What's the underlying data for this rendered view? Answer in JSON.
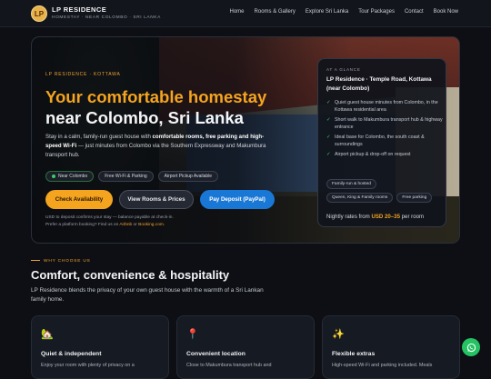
{
  "nav": {
    "logo_text": "LP",
    "brand": "LP RESIDENCE",
    "tagline": "HOMESTAY · NEAR COLOMBO · SRI LANKA",
    "items": [
      "Home",
      "Rooms & Gallery",
      "Explore Sri Lanka",
      "Tour Packages",
      "Contact",
      "Book Now"
    ]
  },
  "hero": {
    "eyebrow": "LP RESIDENCE · KOTTAWA",
    "headline_accent": "Your comfortable homestay",
    "headline_main": "near Colombo, Sri Lanka",
    "lead_1": "Stay in a calm, family-run guest house with ",
    "lead_b1": "comfortable rooms, free parking and high-speed Wi-Fi",
    "lead_2": " — just minutes from Colombo via the Southern Expressway and Makumbura transport hub.",
    "chips": [
      "Near Colombo",
      "Free Wi-Fi & Parking",
      "Airport Pickup Available"
    ],
    "btn_check": "Check Availability",
    "btn_rooms": "View Rooms & Prices",
    "btn_deposit": "Pay Deposit (PayPal)",
    "fine_1": "USD to deposit confirms your stay — balance payable at check-in.",
    "fine_2": "Prefer a platform booking? Find us on ",
    "fine_airbnb": "Airbnb",
    "fine_or": " or ",
    "fine_booking": "Booking.com",
    "fine_end": "."
  },
  "glance": {
    "eyebrow": "AT A GLANCE",
    "title": "LP Residence · Temple Road, Kottawa (near Colombo)",
    "items": [
      "Quiet guest house minutes from Colombo, in the Kottawa residential area",
      "Short walk to Makumbura transport hub & highway entrance",
      "Ideal base for Colombo, the south coast & surroundings",
      "Airport pickup & drop-off on request"
    ],
    "tags": [
      "Family-run & hosted",
      "Queen, King & Family rooms",
      "Free parking"
    ],
    "price_prefix": "Nightly rates from ",
    "price_value": "USD 20–35",
    "price_suffix": " per room"
  },
  "why": {
    "eyebrow": "WHY CHOOSE US",
    "title": "Comfort, convenience & hospitality",
    "lead": "LP Residence blends the privacy of your own guest house with the warmth of a Sri Lankan family home."
  },
  "features": [
    {
      "icon": "🏡",
      "title": "Quiet & independent",
      "desc": "Enjoy your room with plenty of privacy on a"
    },
    {
      "icon": "📍",
      "title": "Convenient location",
      "desc": "Close to Makumbura transport hub and"
    },
    {
      "icon": "✨",
      "title": "Flexible extras",
      "desc": "High-speed Wi-Fi and parking included. Meals"
    }
  ],
  "colors": {
    "accent": "#f4a41f",
    "paypal": "#1977d6",
    "whatsapp": "#25c263"
  }
}
